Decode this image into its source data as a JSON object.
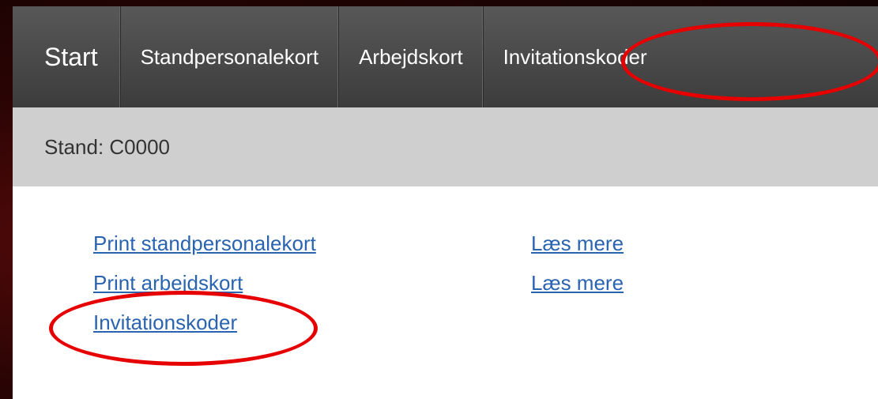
{
  "navbar": {
    "items": [
      {
        "label": "Start"
      },
      {
        "label": "Standpersonalekort"
      },
      {
        "label": "Arbejdskort"
      },
      {
        "label": "Invitationskoder"
      }
    ]
  },
  "subbar": {
    "stand_label": "Stand: C0000"
  },
  "content": {
    "links": [
      {
        "label": "Print standpersonalekort",
        "more": "Læs mere"
      },
      {
        "label": "Print arbejdskort",
        "more": "Læs mere"
      },
      {
        "label": "Invitationskoder"
      }
    ]
  },
  "colors": {
    "navbar_bg": "#464646",
    "subbar_bg": "#cfcfcf",
    "link": "#2a64b0",
    "highlight": "#e60000",
    "backdrop": "#3a0606"
  }
}
